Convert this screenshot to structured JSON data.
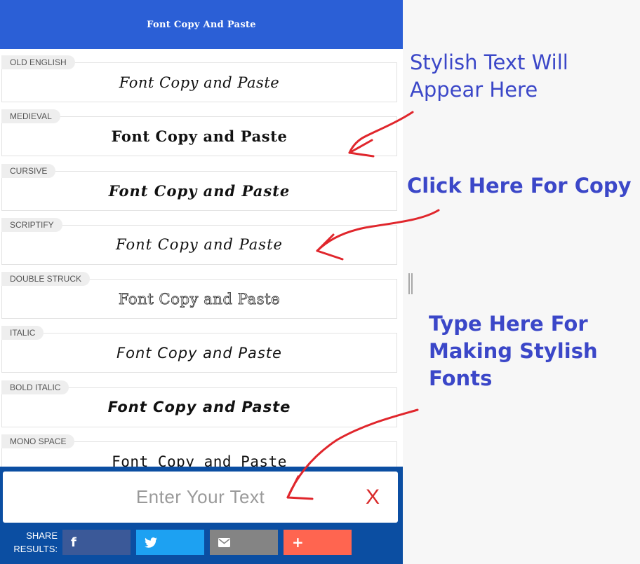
{
  "header": {
    "title": "Font Copy And Paste"
  },
  "styles": [
    {
      "label": "OLD ENGLISH",
      "text": "Font Copy and Paste"
    },
    {
      "label": "MEDIEVAL",
      "text": "Font Copy and Paste"
    },
    {
      "label": "CURSIVE",
      "text": "Font Copy and Paste"
    },
    {
      "label": "SCRIPTIFY",
      "text": "Font Copy and Paste"
    },
    {
      "label": "DOUBLE STRUCK",
      "text": "Font Copy and Paste"
    },
    {
      "label": "ITALIC",
      "text": "Font Copy and Paste"
    },
    {
      "label": "BOLD ITALIC",
      "text": "Font Copy and Paste"
    },
    {
      "label": "MONO SPACE",
      "text": "Font Copy and Paste"
    }
  ],
  "input": {
    "placeholder": "Enter Your Text",
    "value": ""
  },
  "clear_label": "X",
  "share": {
    "label": "SHARE RESULTS:",
    "buttons": [
      {
        "icon": "facebook-icon",
        "color": "#3b5998"
      },
      {
        "icon": "twitter-icon",
        "color": "#1da1f2"
      },
      {
        "icon": "email-icon",
        "color": "#848484"
      },
      {
        "icon": "plus-icon",
        "color": "#ff6550"
      }
    ]
  },
  "annotations": [
    {
      "text": "Stylish Text Will\nAppear Here"
    },
    {
      "text": "Click Here For Copy"
    },
    {
      "text": "Type Here For\nMaking Stylish\nFonts"
    }
  ],
  "colors": {
    "header": "#2b5fd6",
    "bottom_bar": "#0b4ea2",
    "annotation": "#3b47c8",
    "arrow": "#e0262c",
    "clear": "#d92b2b"
  }
}
